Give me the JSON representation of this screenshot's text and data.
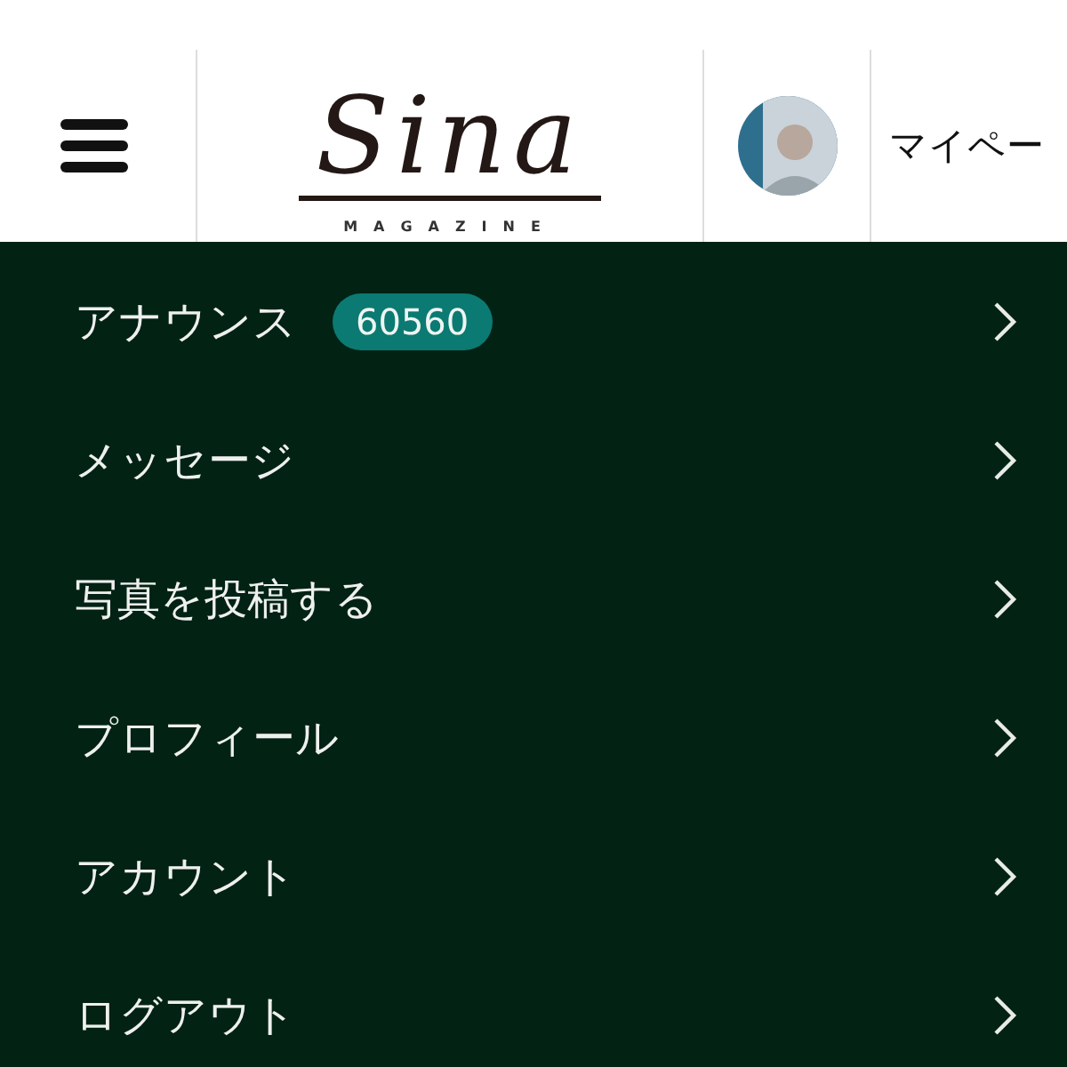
{
  "header": {
    "logo": {
      "wordmark": "Sina",
      "tagline": "MAGAZINE"
    },
    "mypage_label": "マイペー"
  },
  "menu": [
    {
      "label": "アナウンス",
      "badge": "60560"
    },
    {
      "label": "メッセージ"
    },
    {
      "label": "写真を投稿する"
    },
    {
      "label": "プロフィール"
    },
    {
      "label": "アカウント"
    },
    {
      "label": "ログアウト"
    }
  ]
}
